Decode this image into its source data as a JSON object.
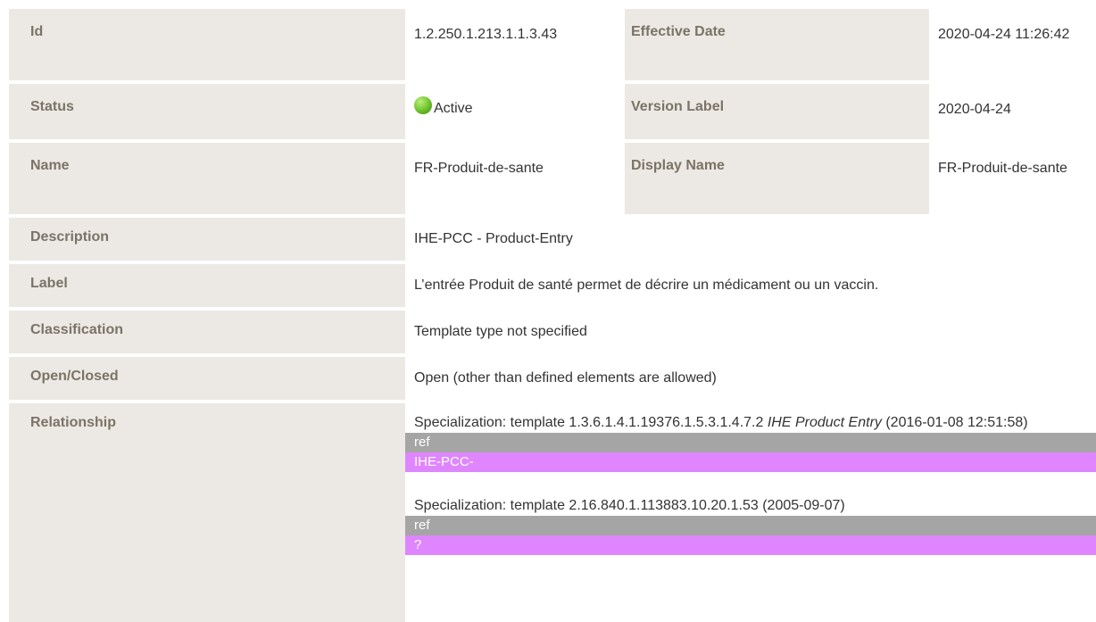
{
  "rows": {
    "id": {
      "label": "Id",
      "value": "1.2.250.1.213.1.1.3.43",
      "label2": "Effective Date",
      "value2": "2020-04-24 11:26:42"
    },
    "status": {
      "label": "Status",
      "value": "Active",
      "label2": "Version Label",
      "value2": "2020-04-24"
    },
    "name": {
      "label": "Name",
      "value": "FR-Produit-de-sante",
      "label2": "Display Name",
      "value2": "FR-Produit-de-sante"
    },
    "description": {
      "label": "Description",
      "value": "IHE-PCC - Product-Entry"
    },
    "label": {
      "label": "Label",
      "value": "L’entrée Produit de santé permet de décrire un médicament ou un vaccin."
    },
    "classification": {
      "label": "Classification",
      "value": "Template type not specified"
    },
    "open_closed": {
      "label": "Open/Closed",
      "value": "Open (other than defined elements are allowed)"
    },
    "relationship": {
      "label": "Relationship",
      "items": [
        {
          "prefix": "Specialization: template 1.3.6.1.4.1.19376.1.5.3.1.4.7.2 ",
          "name": "IHE Product Entry",
          "date": " (2016-01-08 12:51:58)",
          "ref_label": "ref",
          "ref_value": "IHE-PCC-"
        },
        {
          "prefix": "Specialization: template 2.16.840.1.113883.10.20.1.53 (2005-09-07)",
          "name": "",
          "date": "",
          "ref_label": "ref",
          "ref_value": "?"
        }
      ]
    }
  },
  "colors": {
    "label_bg": "#ece9e4",
    "label_text": "#7a7366",
    "ref_bg": "#a5a5a5",
    "ref_value_bg": "#df86ff",
    "status_active": "#6cc02a"
  },
  "icons": {
    "status": "green-status-dot-icon"
  }
}
